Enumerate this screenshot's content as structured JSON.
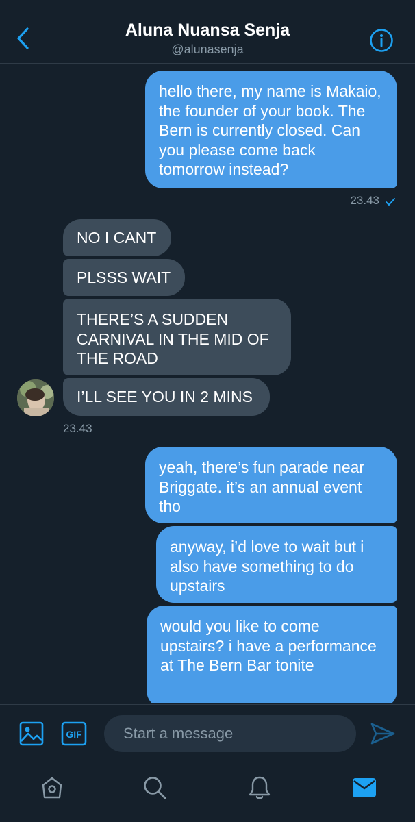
{
  "header": {
    "title": "Aluna Nuansa Senja",
    "handle": "@alunasenja"
  },
  "messages": {
    "m1": "hello there, my name is Makaio, the founder of your book. The Bern is currently closed. Can you please come back tomorrow instead?",
    "t1": "23.43",
    "m2": "NO I CANT",
    "m3": "PLSSS WAIT",
    "m4": "THERE’S A SUDDEN CARNIVAL IN THE MID OF THE ROAD",
    "m5": "I’LL SEE YOU IN 2 MINS",
    "t2": "23.43",
    "m6": "yeah, there’s fun parade near Briggate. it’s an annual event tho",
    "m7": "anyway, i’d love to wait but i also have something to do upstairs",
    "m8": "would you like to come upstairs? i have a performance at The Bern Bar tonite"
  },
  "composer": {
    "placeholder": "Start a message",
    "gif_label": "GIF"
  },
  "icons": {
    "back": "chevron-left-icon",
    "info": "info-icon",
    "image": "image-icon",
    "gif": "gif-icon",
    "send": "send-icon",
    "home": "home-icon",
    "search": "search-icon",
    "notifications": "bell-icon",
    "messages": "mail-icon"
  },
  "colors": {
    "background": "#15202b",
    "accent": "#1da1f2",
    "outgoing_bubble": "#4a9ce8",
    "incoming_bubble": "#3d4c5a",
    "muted_text": "#8899a6"
  }
}
